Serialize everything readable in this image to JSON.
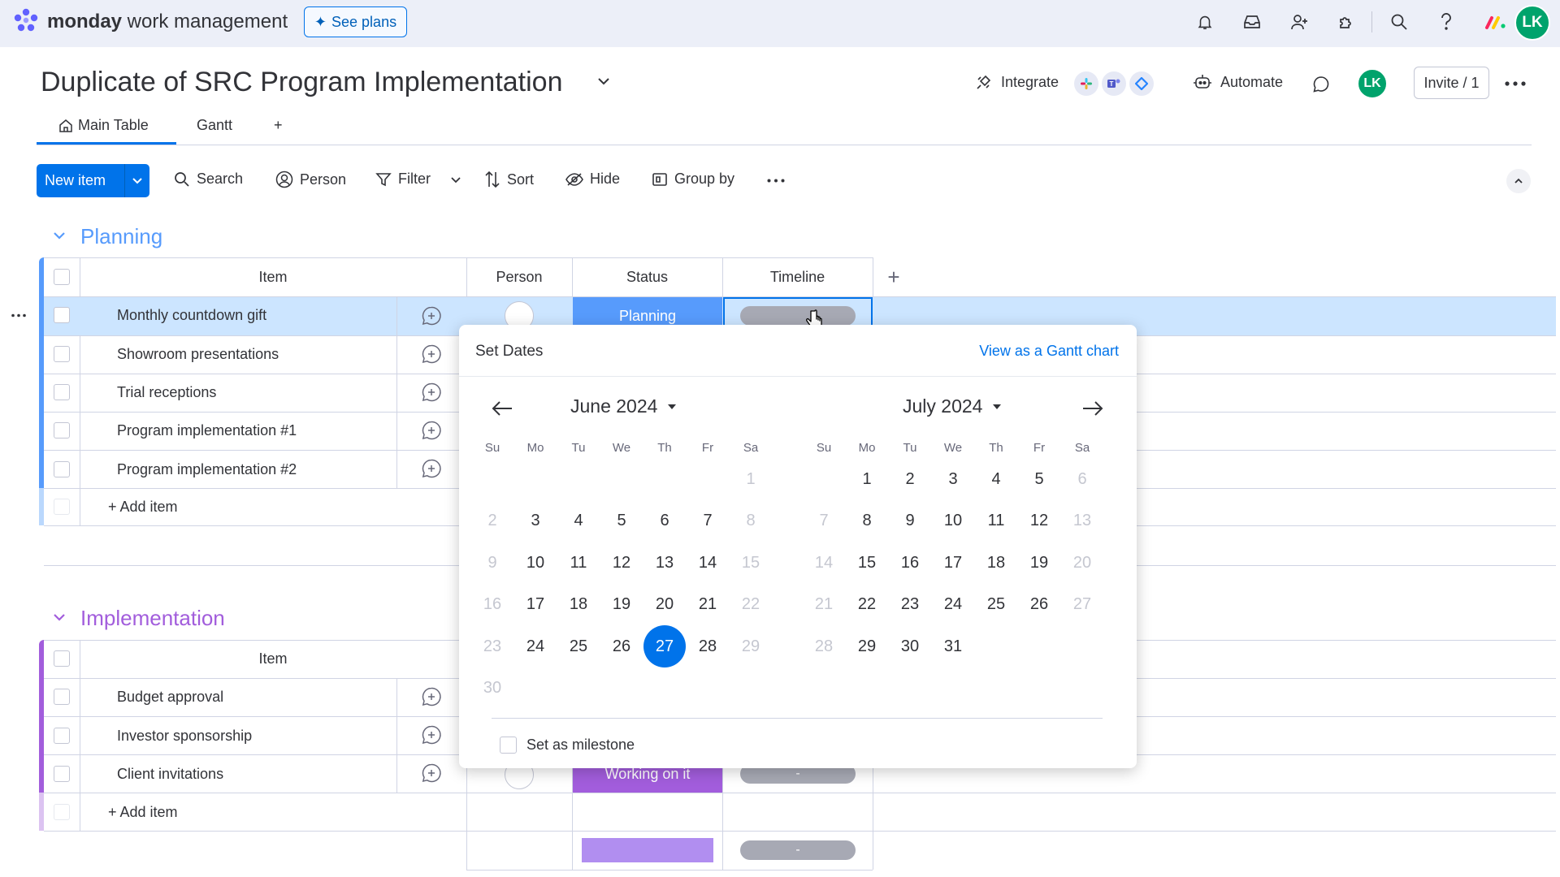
{
  "topbar": {
    "brand_bold": "monday",
    "brand_rest": " work management",
    "see_plans": "See plans",
    "user_initials": "LK",
    "accent": "#0073ea",
    "avatar_color": "#00a36c"
  },
  "header": {
    "title": "Duplicate of SRC Program Implementation",
    "integrate": "Integrate",
    "automate": "Automate",
    "member_initials": "LK",
    "invite": "Invite / 1"
  },
  "tabs": [
    {
      "label": "Main Table",
      "active": true
    },
    {
      "label": "Gantt",
      "active": false
    }
  ],
  "tab_add": "+",
  "toolbar": {
    "new_item": "New item",
    "search": "Search",
    "person": "Person",
    "filter": "Filter",
    "sort": "Sort",
    "hide": "Hide",
    "group_by": "Group by"
  },
  "columns": {
    "item": "Item",
    "person": "Person",
    "status": "Status",
    "timeline": "Timeline",
    "add": "+"
  },
  "groups": [
    {
      "title": "Planning",
      "color": "#579bfc",
      "items": [
        {
          "name": "Monthly countdown gift",
          "status": "Planning"
        },
        {
          "name": "Showroom presentations"
        },
        {
          "name": "Trial receptions"
        },
        {
          "name": "Program implementation #1"
        },
        {
          "name": "Program implementation #2"
        }
      ],
      "add_item": "+ Add item"
    },
    {
      "title": "Implementation",
      "color": "#a25ddc",
      "items": [
        {
          "name": "Budget approval"
        },
        {
          "name": "Investor sponsorship"
        },
        {
          "name": "Client invitations",
          "status": "Working on it",
          "timeline": "-"
        }
      ],
      "add_item": "+ Add item",
      "summary_timeline": "-"
    }
  ],
  "status_colors": {
    "planning": "#579bfc",
    "working": "#a25ddc",
    "summary": "#b18ef0"
  },
  "date_picker": {
    "title": "Set Dates",
    "gantt_link": "View as a Gantt chart",
    "weekdays": [
      "Su",
      "Mo",
      "Tu",
      "We",
      "Th",
      "Fr",
      "Sa"
    ],
    "left_month": "June 2024",
    "right_month": "July 2024",
    "selected_day": "27",
    "milestone": "Set as milestone",
    "june_weeks": [
      [
        "",
        "",
        "",
        "",
        "",
        "",
        "1"
      ],
      [
        "2",
        "3",
        "4",
        "5",
        "6",
        "7",
        "8"
      ],
      [
        "9",
        "10",
        "11",
        "12",
        "13",
        "14",
        "15"
      ],
      [
        "16",
        "17",
        "18",
        "19",
        "20",
        "21",
        "22"
      ],
      [
        "23",
        "24",
        "25",
        "26",
        "27",
        "28",
        "29"
      ],
      [
        "30",
        "",
        "",
        "",
        "",
        "",
        ""
      ]
    ],
    "july_weeks": [
      [
        "",
        "1",
        "2",
        "3",
        "4",
        "5",
        "6"
      ],
      [
        "7",
        "8",
        "9",
        "10",
        "11",
        "12",
        "13"
      ],
      [
        "14",
        "15",
        "16",
        "17",
        "18",
        "19",
        "20"
      ],
      [
        "21",
        "22",
        "23",
        "24",
        "25",
        "26",
        "27"
      ],
      [
        "28",
        "29",
        "30",
        "31",
        "",
        "",
        ""
      ]
    ]
  }
}
